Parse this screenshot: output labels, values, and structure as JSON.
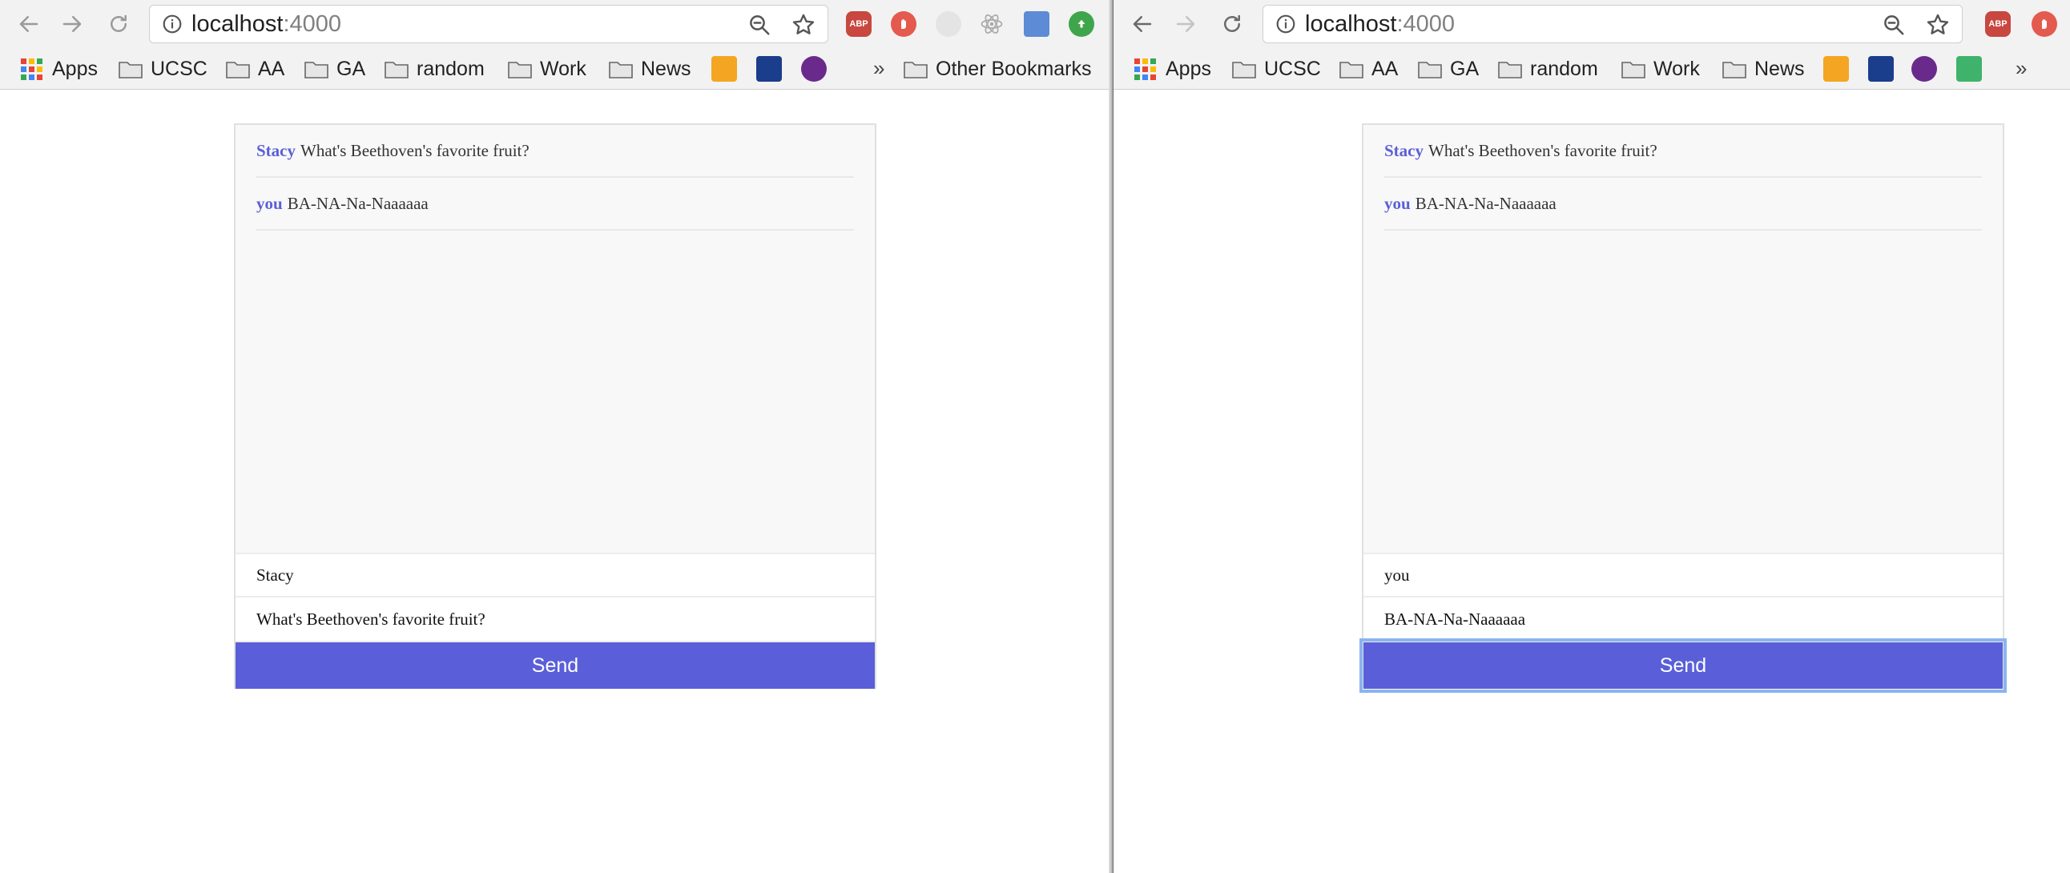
{
  "windows": [
    {
      "id": "left",
      "url_host": "localhost",
      "url_port": ":4000",
      "bookmarks": [
        "Apps",
        "UCSC",
        "AA",
        "GA",
        "random",
        "Work",
        "News"
      ],
      "overflow_label": "»",
      "other_bookmarks": "Other Bookmarks",
      "chat": {
        "messages": [
          {
            "name": "Stacy",
            "text": "What's Beethoven's favorite fruit?"
          },
          {
            "name": "you",
            "text": "BA-NA-Na-Naaaaaa"
          }
        ],
        "name_input_value": "Stacy",
        "message_input_value": "What's Beethoven's favorite fruit?",
        "send_label": "Send"
      }
    },
    {
      "id": "right",
      "url_host": "localhost",
      "url_port": ":4000",
      "bookmarks": [
        "Apps",
        "UCSC",
        "AA",
        "GA",
        "random",
        "Work",
        "News"
      ],
      "overflow_label": "»",
      "chat": {
        "messages": [
          {
            "name": "Stacy",
            "text": "What's Beethoven's favorite fruit?"
          },
          {
            "name": "you",
            "text": "BA-NA-Na-Naaaaaa"
          }
        ],
        "name_input_value": "you",
        "message_input_value": "BA-NA-Na-Naaaaaa",
        "send_label": "Send"
      }
    }
  ],
  "colors": {
    "accent": "#5a5fd9",
    "name_color": "#5a5fd6",
    "focus_ring": "#8ab4f0"
  },
  "icons": [
    "back-icon",
    "forward-icon",
    "reload-icon",
    "info-icon",
    "zoom-icon",
    "star-icon",
    "folder-icon",
    "apps-icon",
    "adblock-icon",
    "hand-icon",
    "ghost-icon",
    "atom-icon",
    "fest-icon",
    "upload-icon"
  ]
}
